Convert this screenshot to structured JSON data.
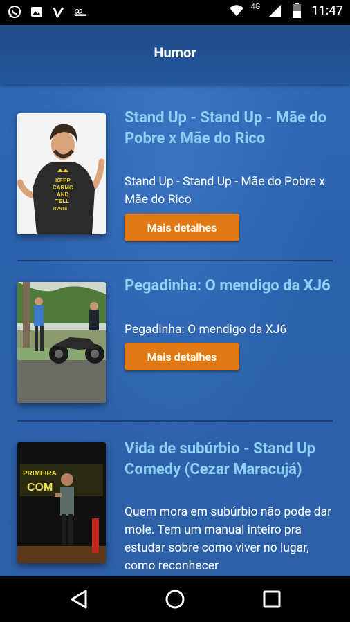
{
  "status_bar": {
    "network": "4G",
    "time": "11:47"
  },
  "header": {
    "title": "Humor"
  },
  "items": [
    {
      "title": "Stand Up - Stand Up - Mãe do Pobre x Mãe do Rico",
      "description": "Stand Up - Stand Up - Mãe do Pobre x Mãe do Rico",
      "button": "Mais detalhes",
      "shirt_text": "KEEP CARMO AND TELL RVNTS"
    },
    {
      "title": "Pegadinha: O mendigo da XJ6",
      "description": "Pegadinha: O mendigo da XJ6",
      "button": "Mais detalhes"
    },
    {
      "title": "Vida de subúrbio - Stand Up Comedy (Cezar Maracujá)",
      "description": "Quem mora em subúrbio não pode dar mole. Tem um manual inteiro pra estudar sobre como viver no lugar, como reconhecer",
      "banner_line1": "PRIMEIRA",
      "banner_line2": "COM"
    }
  ],
  "colors": {
    "accent_button": "#e07913",
    "title_text": "#8fd0f5",
    "background": "#2f6bb6",
    "header": "#1f4a86"
  },
  "icons": [
    "whatsapp-icon",
    "gallery-icon",
    "vine-icon",
    "app-icon",
    "wifi-icon",
    "signal-icon",
    "battery-icon",
    "back-icon",
    "home-icon",
    "recents-icon"
  ]
}
